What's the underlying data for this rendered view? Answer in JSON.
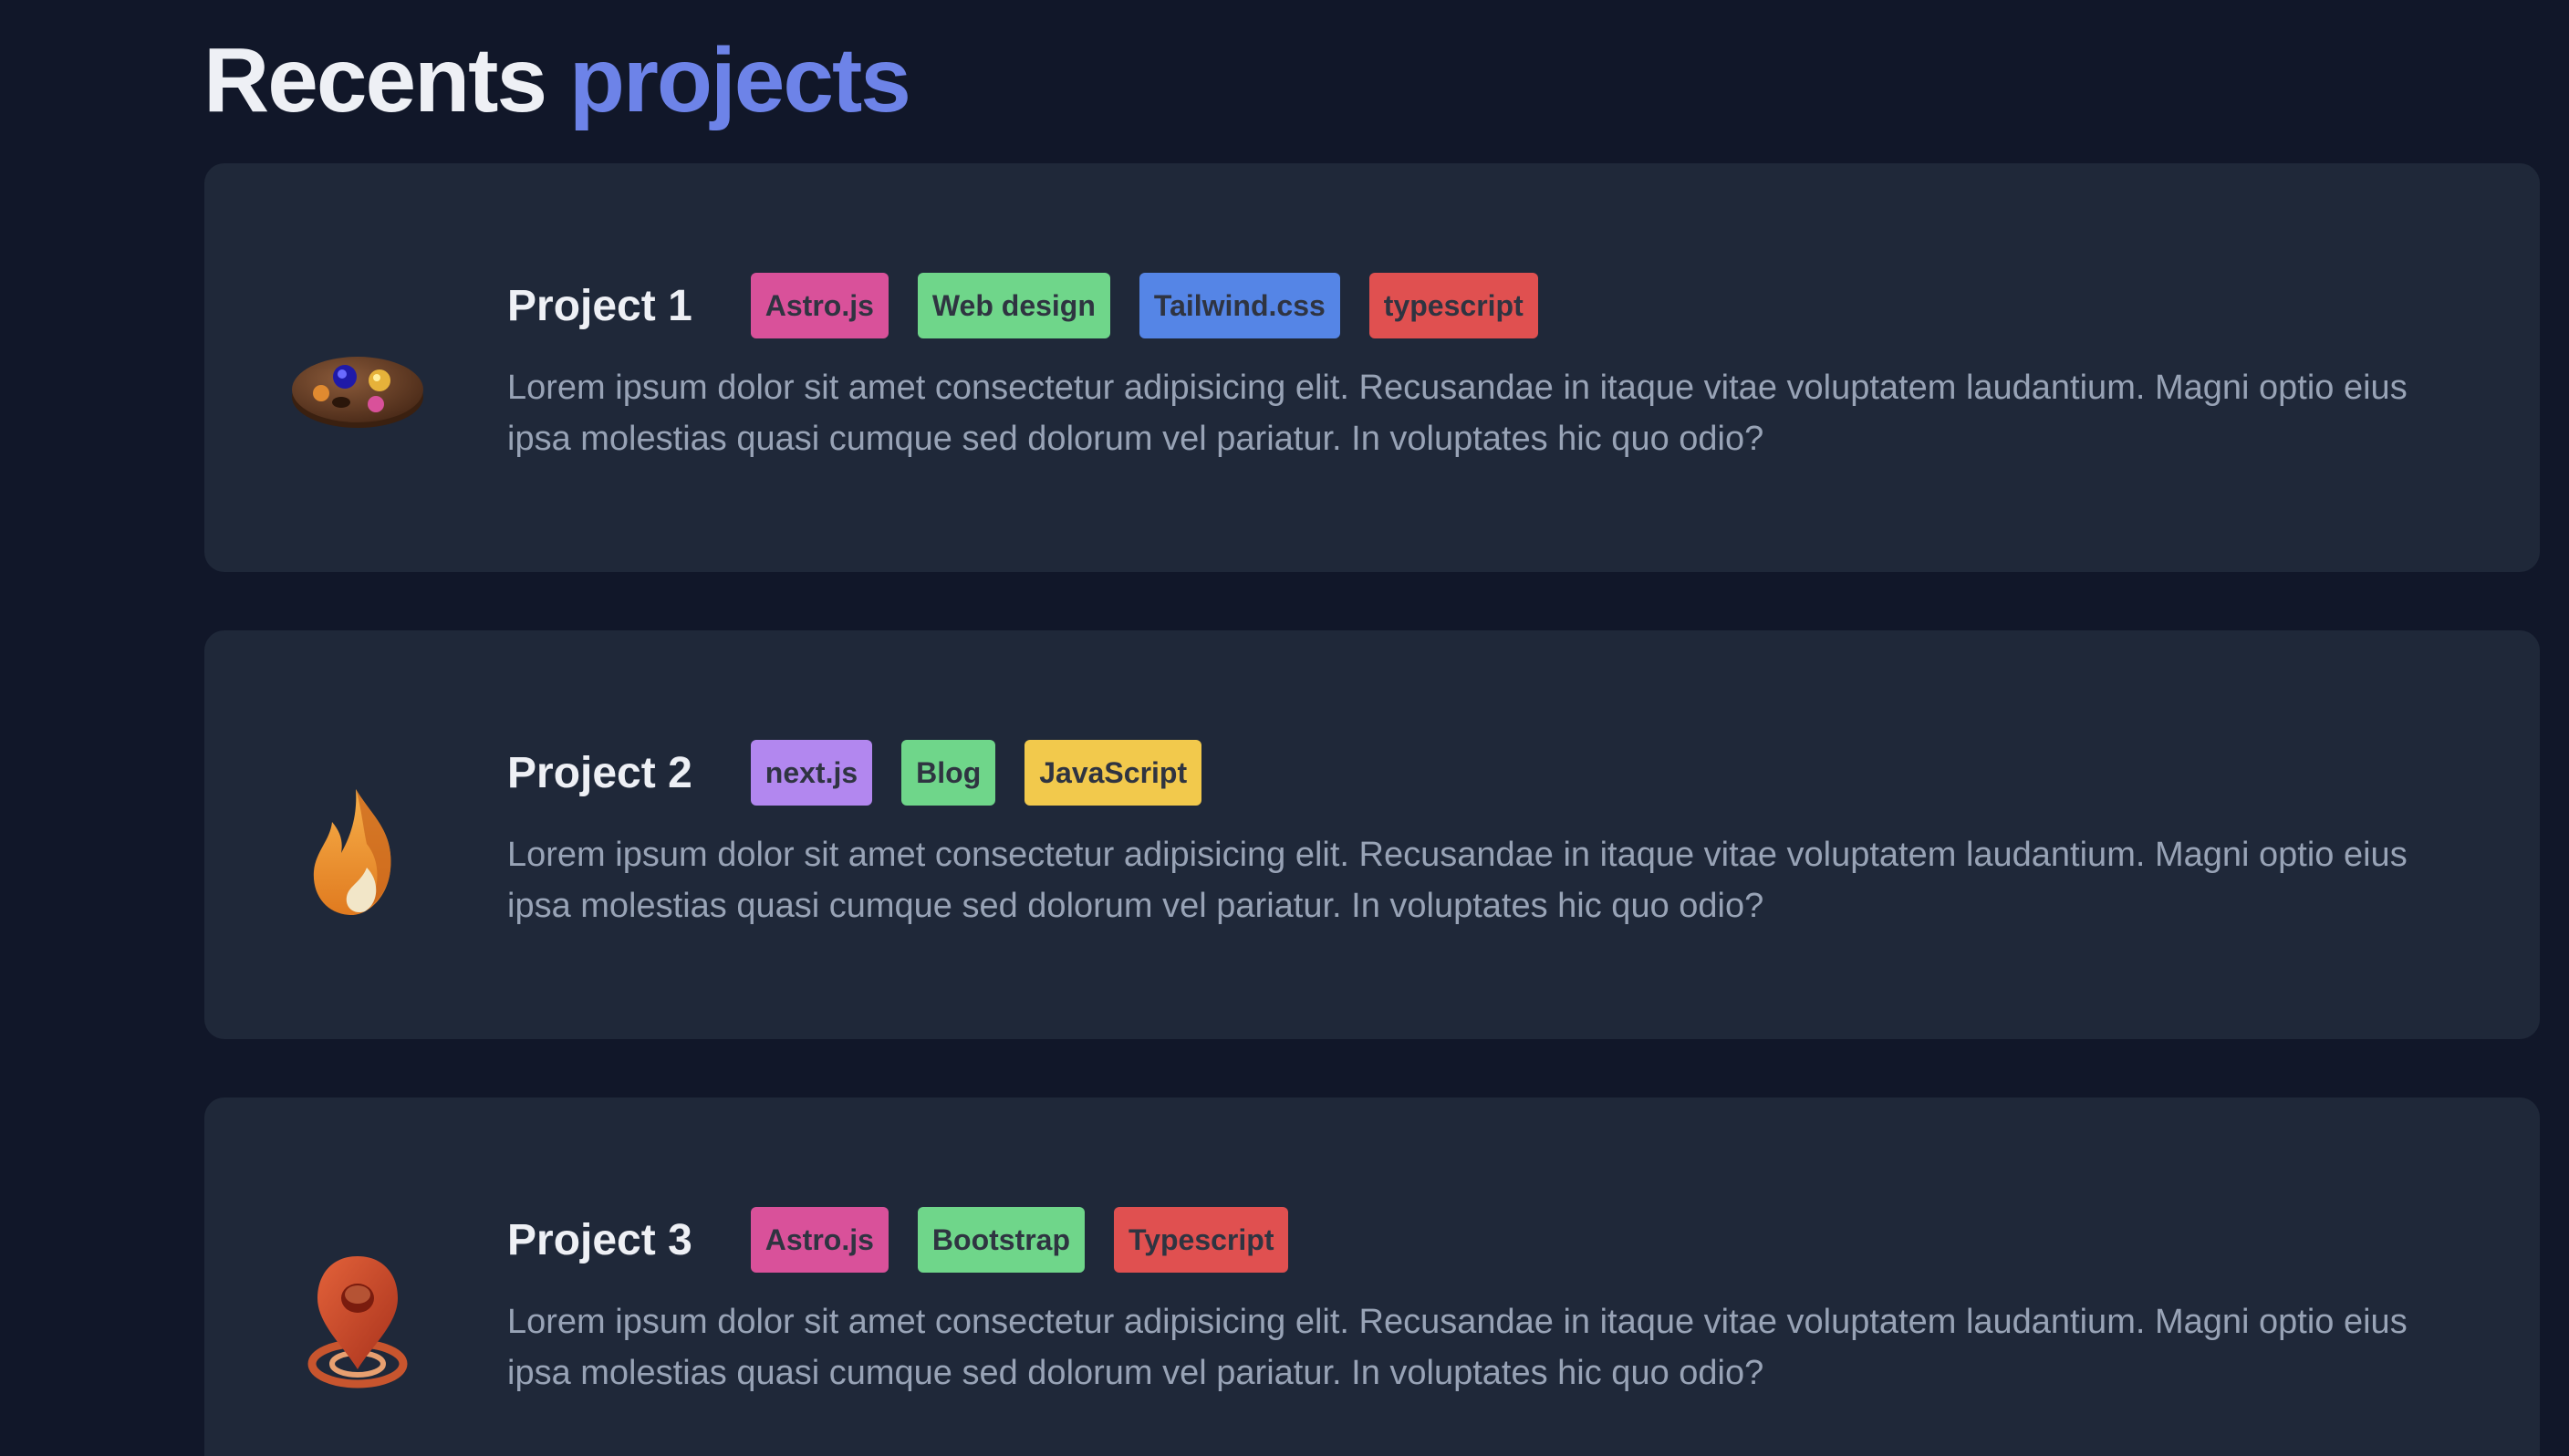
{
  "heading": {
    "word1": "Recents",
    "word2": "projects"
  },
  "projects": [
    {
      "title": "Project 1",
      "icon": "palette-icon",
      "tags": [
        {
          "label": "Astro.js",
          "color": "#d9519a"
        },
        {
          "label": "Web design",
          "color": "#6fd68a"
        },
        {
          "label": "Tailwind.css",
          "color": "#5585e6"
        },
        {
          "label": "typescript",
          "color": "#e05050"
        }
      ],
      "description": "Lorem ipsum dolor sit amet consectetur adipisicing elit. Recusandae in itaque vitae voluptatem laudantium. Magni optio eius ipsa molestias quasi cumque sed dolorum vel pariatur. In voluptates hic quo odio?"
    },
    {
      "title": "Project 2",
      "icon": "fire-icon",
      "tags": [
        {
          "label": "next.js",
          "color": "#b287ef"
        },
        {
          "label": "Blog",
          "color": "#6fd68a"
        },
        {
          "label": "JavaScript",
          "color": "#f2c94c"
        }
      ],
      "description": "Lorem ipsum dolor sit amet consectetur adipisicing elit. Recusandae in itaque vitae voluptatem laudantium. Magni optio eius ipsa molestias quasi cumque sed dolorum vel pariatur. In voluptates hic quo odio?"
    },
    {
      "title": "Project 3",
      "icon": "map-pin-icon",
      "tags": [
        {
          "label": "Astro.js",
          "color": "#d9519a"
        },
        {
          "label": "Bootstrap",
          "color": "#6fd68a"
        },
        {
          "label": "Typescript",
          "color": "#e05050"
        }
      ],
      "description": "Lorem ipsum dolor sit amet consectetur adipisicing elit. Recusandae in itaque vitae voluptatem laudantium. Magni optio eius ipsa molestias quasi cumque sed dolorum vel pariatur. In voluptates hic quo odio?"
    }
  ],
  "colors": {
    "background": "#111729",
    "card": "#1f2839",
    "accent": "#6d83e8",
    "title_text": "#eef0f5",
    "body_text": "#98a3b6",
    "tag_text": "#2f3441"
  }
}
